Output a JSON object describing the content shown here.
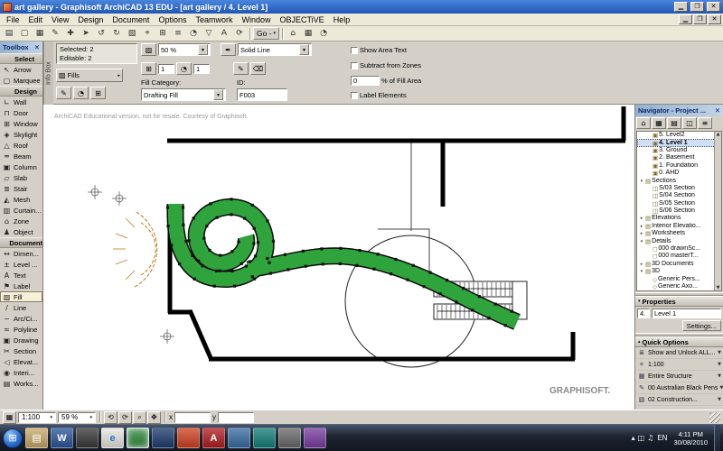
{
  "titlebar": {
    "title": "art gallery - Graphisoft ArchiCAD 13 EDU - [art gallery / 4. Level 1]"
  },
  "menubar": {
    "items": [
      "File",
      "Edit",
      "View",
      "Design",
      "Document",
      "Options",
      "Teamwork",
      "Window",
      "OBJECTiVE",
      "Help"
    ]
  },
  "toolbar": {
    "icons": [
      "▤",
      "▢",
      "▦",
      "✎",
      "✚",
      "➤",
      "↺",
      "↻",
      "▧",
      "⌖",
      "⊞",
      "≡",
      "◔",
      "▽",
      "A",
      "⟳"
    ],
    "go_label": "Go -",
    "right_icons": [
      "⌂",
      "▦",
      "◔"
    ]
  },
  "infobox": {
    "tab_label": "Info Box",
    "selected": "Selected: 2",
    "editable": "Editable: 2",
    "fills_button": "Fills",
    "opacity": "50 %",
    "line_type": "Solid Line",
    "spin1": "1",
    "spin2": "1",
    "fill_category_label": "Fill Category:",
    "fill_category_value": "Drafting Fill",
    "id_label": "ID:",
    "id_value": "F003",
    "show_area_text": "Show Area Text",
    "subtract_from_zones": "Subtract from Zones",
    "fill_area_value": "0",
    "fill_area_suffix": "% of Fill Area",
    "label_elements": "Label Elements"
  },
  "toolbox": {
    "title": "Toolbox",
    "rows": [
      {
        "label": "Select",
        "header": true
      },
      {
        "label": "Arrow",
        "glyph": "↖"
      },
      {
        "label": "Marquee",
        "glyph": "▢"
      },
      {
        "label": "Design",
        "header": true
      },
      {
        "label": "Wall",
        "glyph": "∟"
      },
      {
        "label": "Door",
        "glyph": "⊓"
      },
      {
        "label": "Window",
        "glyph": "⊞"
      },
      {
        "label": "Skylight",
        "glyph": "◈"
      },
      {
        "label": "Roof",
        "glyph": "△"
      },
      {
        "label": "Beam",
        "glyph": "═"
      },
      {
        "label": "Column",
        "glyph": "▣"
      },
      {
        "label": "Slab",
        "glyph": "▱"
      },
      {
        "label": "Stair",
        "glyph": "≣"
      },
      {
        "label": "Mesh",
        "glyph": "◭"
      },
      {
        "label": "Curtain...",
        "glyph": "▥"
      },
      {
        "label": "Zone",
        "glyph": "⌂"
      },
      {
        "label": "Object",
        "glyph": "♟"
      },
      {
        "label": "Document",
        "header": true
      },
      {
        "label": "Dimen...",
        "glyph": "↔"
      },
      {
        "label": "Level ...",
        "glyph": "±"
      },
      {
        "label": "Text",
        "glyph": "A"
      },
      {
        "label": "Label",
        "glyph": "⚑"
      },
      {
        "label": "Fill",
        "glyph": "▨",
        "active": true
      },
      {
        "label": "Line",
        "glyph": "/"
      },
      {
        "label": "Arc/Ci...",
        "glyph": "~"
      },
      {
        "label": "Polyline",
        "glyph": "≈"
      },
      {
        "label": "Drawing",
        "glyph": "▣"
      },
      {
        "label": "Section",
        "glyph": "✂"
      },
      {
        "label": "Elevat...",
        "glyph": "◁"
      },
      {
        "label": "Interi...",
        "glyph": "◉"
      },
      {
        "label": "Works...",
        "glyph": "▤"
      }
    ]
  },
  "canvas": {
    "watermark": "ArchiCAD Educational version, not for resale. Courtesy of Graphisoft.",
    "fill_color": "#2fa43c"
  },
  "navigator": {
    "title": "Navigator - Project ...",
    "toolbar_icons": [
      "⌂",
      "▦",
      "▤",
      "◫",
      "≡"
    ],
    "tree": [
      {
        "arrow": "",
        "glyph": "▣",
        "label": "5. Level2",
        "depth": 1
      },
      {
        "arrow": "",
        "glyph": "▣",
        "label": "4. Level 1",
        "depth": 1,
        "selected": true
      },
      {
        "arrow": "",
        "glyph": "▣",
        "label": "3. Ground",
        "depth": 1
      },
      {
        "arrow": "",
        "glyph": "▣",
        "label": "2. Basement",
        "depth": 1
      },
      {
        "arrow": "",
        "glyph": "▣",
        "label": "1. Foundation",
        "depth": 1
      },
      {
        "arrow": "",
        "glyph": "▣",
        "label": "0. AHD",
        "depth": 1
      },
      {
        "arrow": "▾",
        "glyph": "▤",
        "label": "Sections",
        "depth": 0
      },
      {
        "arrow": "",
        "glyph": "◫",
        "label": "S/03 Section",
        "depth": 1
      },
      {
        "arrow": "",
        "glyph": "◫",
        "label": "S/04 Section",
        "depth": 1
      },
      {
        "arrow": "",
        "glyph": "◫",
        "label": "S/05 Section",
        "depth": 1
      },
      {
        "arrow": "",
        "glyph": "◫",
        "label": "S/06 Section",
        "depth": 1
      },
      {
        "arrow": "▸",
        "glyph": "▤",
        "label": "Elevations",
        "depth": 0
      },
      {
        "arrow": "▸",
        "glyph": "▤",
        "label": "Interior Elevatio...",
        "depth": 0
      },
      {
        "arrow": "▸",
        "glyph": "▤",
        "label": "Worksheets",
        "depth": 0
      },
      {
        "arrow": "▾",
        "glyph": "▤",
        "label": "Details",
        "depth": 0
      },
      {
        "arrow": "",
        "glyph": "◻",
        "label": "000 drawnSc...",
        "depth": 1
      },
      {
        "arrow": "",
        "glyph": "◻",
        "label": "000 masterT...",
        "depth": 1
      },
      {
        "arrow": "▸",
        "glyph": "▤",
        "label": "3D Documents",
        "depth": 0
      },
      {
        "arrow": "▾",
        "glyph": "▤",
        "label": "3D",
        "depth": 0
      },
      {
        "arrow": "",
        "glyph": "◇",
        "label": "Generic Pers...",
        "depth": 1
      },
      {
        "arrow": "",
        "glyph": "◇",
        "label": "Generic Axo...",
        "depth": 1
      }
    ]
  },
  "properties": {
    "title": "Properties",
    "story_number": "4.",
    "story_name": "Level 1",
    "settings": "Settings..."
  },
  "quick_options": {
    "title": "Quick Options",
    "items": [
      {
        "glyph": "≣",
        "label": "Show and Unlock ALL..."
      },
      {
        "glyph": "⌗",
        "label": "1:100"
      },
      {
        "glyph": "▦",
        "label": "Entire Structure"
      },
      {
        "glyph": "✎",
        "label": "00 Australian Black Pens"
      },
      {
        "glyph": "▧",
        "label": "02 Construction..."
      }
    ]
  },
  "statusbar": {
    "scale": "1:100",
    "zoom": "59 %",
    "icons": [
      "⟲",
      "⟳",
      "⌕",
      "✥"
    ],
    "coord_x_label": "x",
    "coord_y_label": "y"
  },
  "taskbar": {
    "start_glyph": "⊞",
    "apps": [
      {
        "color": "#c9a96a",
        "glyph": "▤"
      },
      {
        "color": "#2b579a",
        "glyph": "W"
      },
      {
        "color": "#3a3a3a",
        "glyph": ""
      },
      {
        "color": "#e8e6e0",
        "glyph": "e",
        "glyph_color": "#2a6fd4"
      },
      {
        "color": "#2e8b3a",
        "glyph": "",
        "active": true
      },
      {
        "color": "#1f3d6e",
        "glyph": ""
      },
      {
        "color": "#d04423",
        "glyph": ""
      },
      {
        "color": "#b01f24",
        "glyph": "A"
      },
      {
        "color": "#3a6ea5",
        "glyph": ""
      },
      {
        "color": "#17807a",
        "glyph": ""
      },
      {
        "color": "#6a6a6a",
        "glyph": ""
      },
      {
        "color": "#7a3fa0",
        "glyph": ""
      }
    ],
    "tray_icons": [
      "▴",
      "◫",
      "♫"
    ],
    "lang": "EN",
    "time": "4:11 PM",
    "date": "30/08/2010"
  }
}
